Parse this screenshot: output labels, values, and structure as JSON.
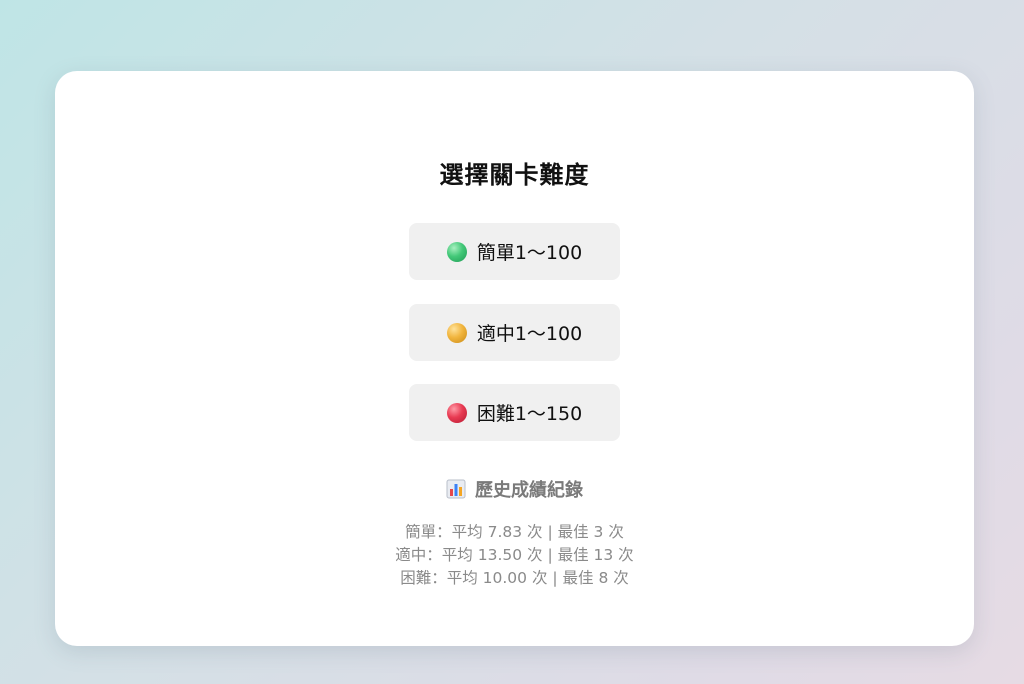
{
  "page": {
    "title": "選擇關卡難度"
  },
  "levels": [
    {
      "id": "easy",
      "icon": "green-circle-icon",
      "label": "簡單1～100",
      "color": "#3fc777"
    },
    {
      "id": "medium",
      "icon": "yellow-circle-icon",
      "label": "適中1～100",
      "color": "#f0b23c"
    },
    {
      "id": "hard",
      "icon": "red-circle-icon",
      "label": "困難1～150",
      "color": "#e63a50"
    }
  ],
  "history": {
    "icon": "bar-chart-icon",
    "title": "歷史成績紀錄",
    "records": [
      "簡單：平均 7.83 次 | 最佳 3 次",
      "適中：平均 13.50 次 | 最佳 13 次",
      "困難：平均 10.00 次 | 最佳 8 次"
    ]
  }
}
